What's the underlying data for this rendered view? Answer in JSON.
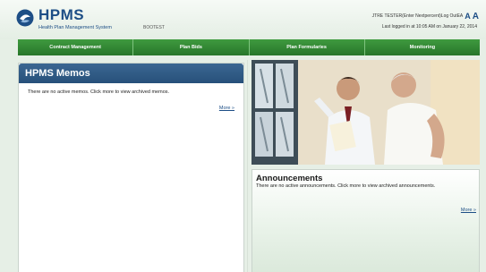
{
  "header": {
    "logo_title": "HPMS",
    "logo_subtitle": "Health Plan Management System",
    "environment": "BOOTEST",
    "user_info": "JTRE TESTER(Enter Nextpercent)Log OutEA",
    "font_small": "A",
    "font_large": "A",
    "last_login": "Last logged in at 10:05 AM on January 22, 2014"
  },
  "nav": {
    "items": [
      "Contract Management",
      "Plan Bids",
      "Plan Formularies",
      "Monitoring"
    ]
  },
  "memos": {
    "title": "HPMS Memos",
    "text": "There are no active memos. Click more to view archived memos.",
    "more_link": "More »"
  },
  "announcements": {
    "title": "Announcements",
    "text": "There are no active announcements. Click more to view archived announcements.",
    "more_link": "More »"
  },
  "colors": {
    "nav_green": "#2e8a30",
    "memo_header_blue": "#2f5c86",
    "brand_blue": "#1d4e86"
  },
  "icons": {
    "logo": "hpms-logo-icon"
  }
}
